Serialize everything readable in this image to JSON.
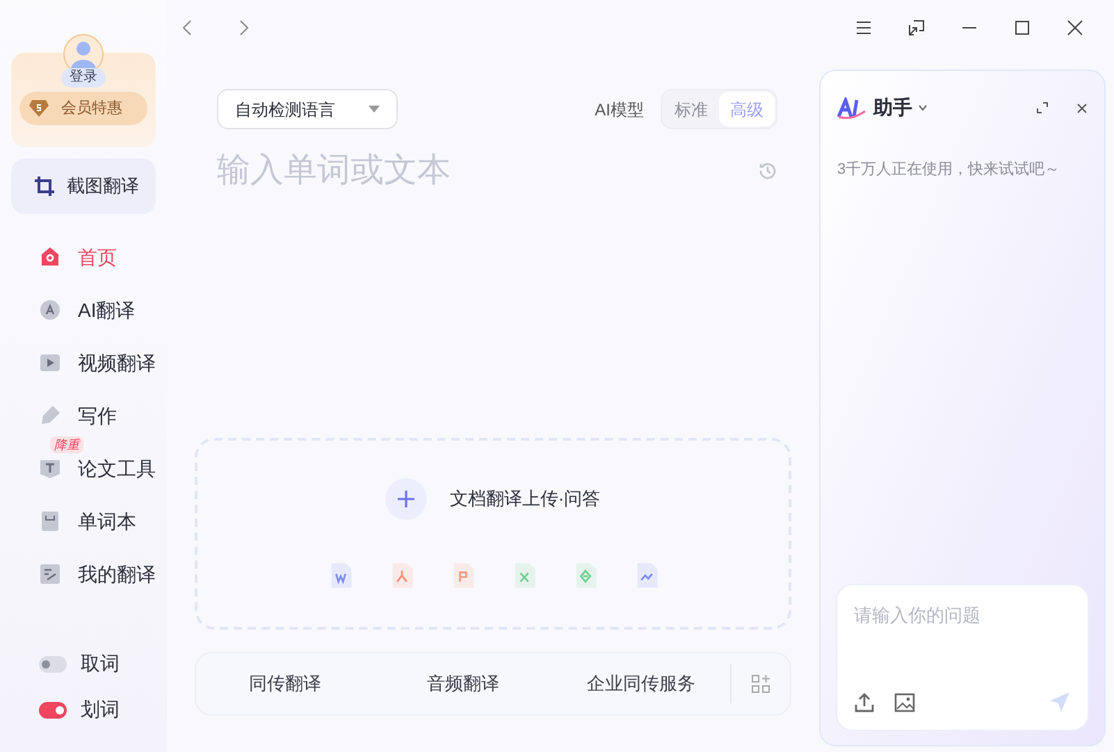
{
  "account": {
    "login": "登录",
    "vip": "会员特惠"
  },
  "screenshot_translate": "截图翻译",
  "nav": [
    {
      "label": "首页",
      "selected": true,
      "kind": "home"
    },
    {
      "label": "AI翻译",
      "selected": false,
      "kind": "ai"
    },
    {
      "label": "视频翻译",
      "selected": false,
      "kind": "video"
    },
    {
      "label": "写作",
      "selected": false,
      "kind": "write"
    },
    {
      "label": "论文工具",
      "selected": false,
      "kind": "paper",
      "badge": "降重"
    },
    {
      "label": "单词本",
      "selected": false,
      "kind": "words"
    },
    {
      "label": "我的翻译",
      "selected": false,
      "kind": "mine"
    }
  ],
  "toggles": [
    {
      "label": "取词",
      "on": false
    },
    {
      "label": "划词",
      "on": true
    }
  ],
  "language": "自动检测语言",
  "model": {
    "label": "AI模型",
    "options": [
      {
        "label": "标准",
        "selected": false
      },
      {
        "label": "高级",
        "selected": true
      }
    ]
  },
  "input": {
    "placeholder": "输入单词或文本"
  },
  "upload": {
    "label": "文档翻译上传·问答"
  },
  "bottom_tabs": [
    "同传翻译",
    "音频翻译",
    "企业同传服务"
  ],
  "assistant": {
    "title": "助手",
    "hint": "3千万人正在使用，快来试试吧～",
    "input_placeholder": "请输入你的问题"
  }
}
